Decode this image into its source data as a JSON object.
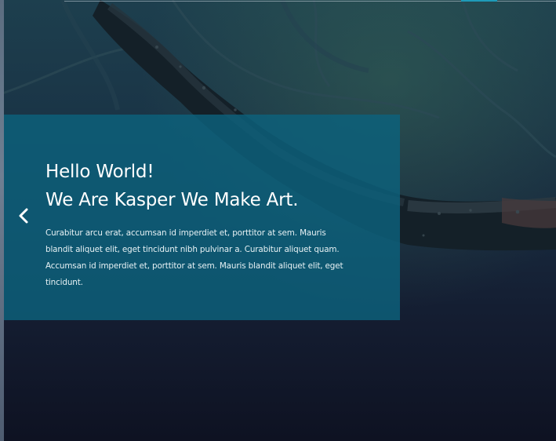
{
  "slider": {
    "title_line1": "Hello World!",
    "title_line2": "We Are Kasper We Make Art.",
    "description": "Curabitur arcu erat, accumsan id imperdiet et, porttitor at sem. Mauris blandit aliquet elit, eget tincidunt nibh pulvinar a. Curabitur aliquet quam. Accumsan id imperdiet et, porttitor at sem. Mauris blandit aliquet elit, eget tincidunt.",
    "prev_icon": "chevron-left-icon"
  },
  "colors": {
    "overlay": "#0c627c",
    "accent": "#1e9bb8",
    "text": "#ffffff"
  }
}
